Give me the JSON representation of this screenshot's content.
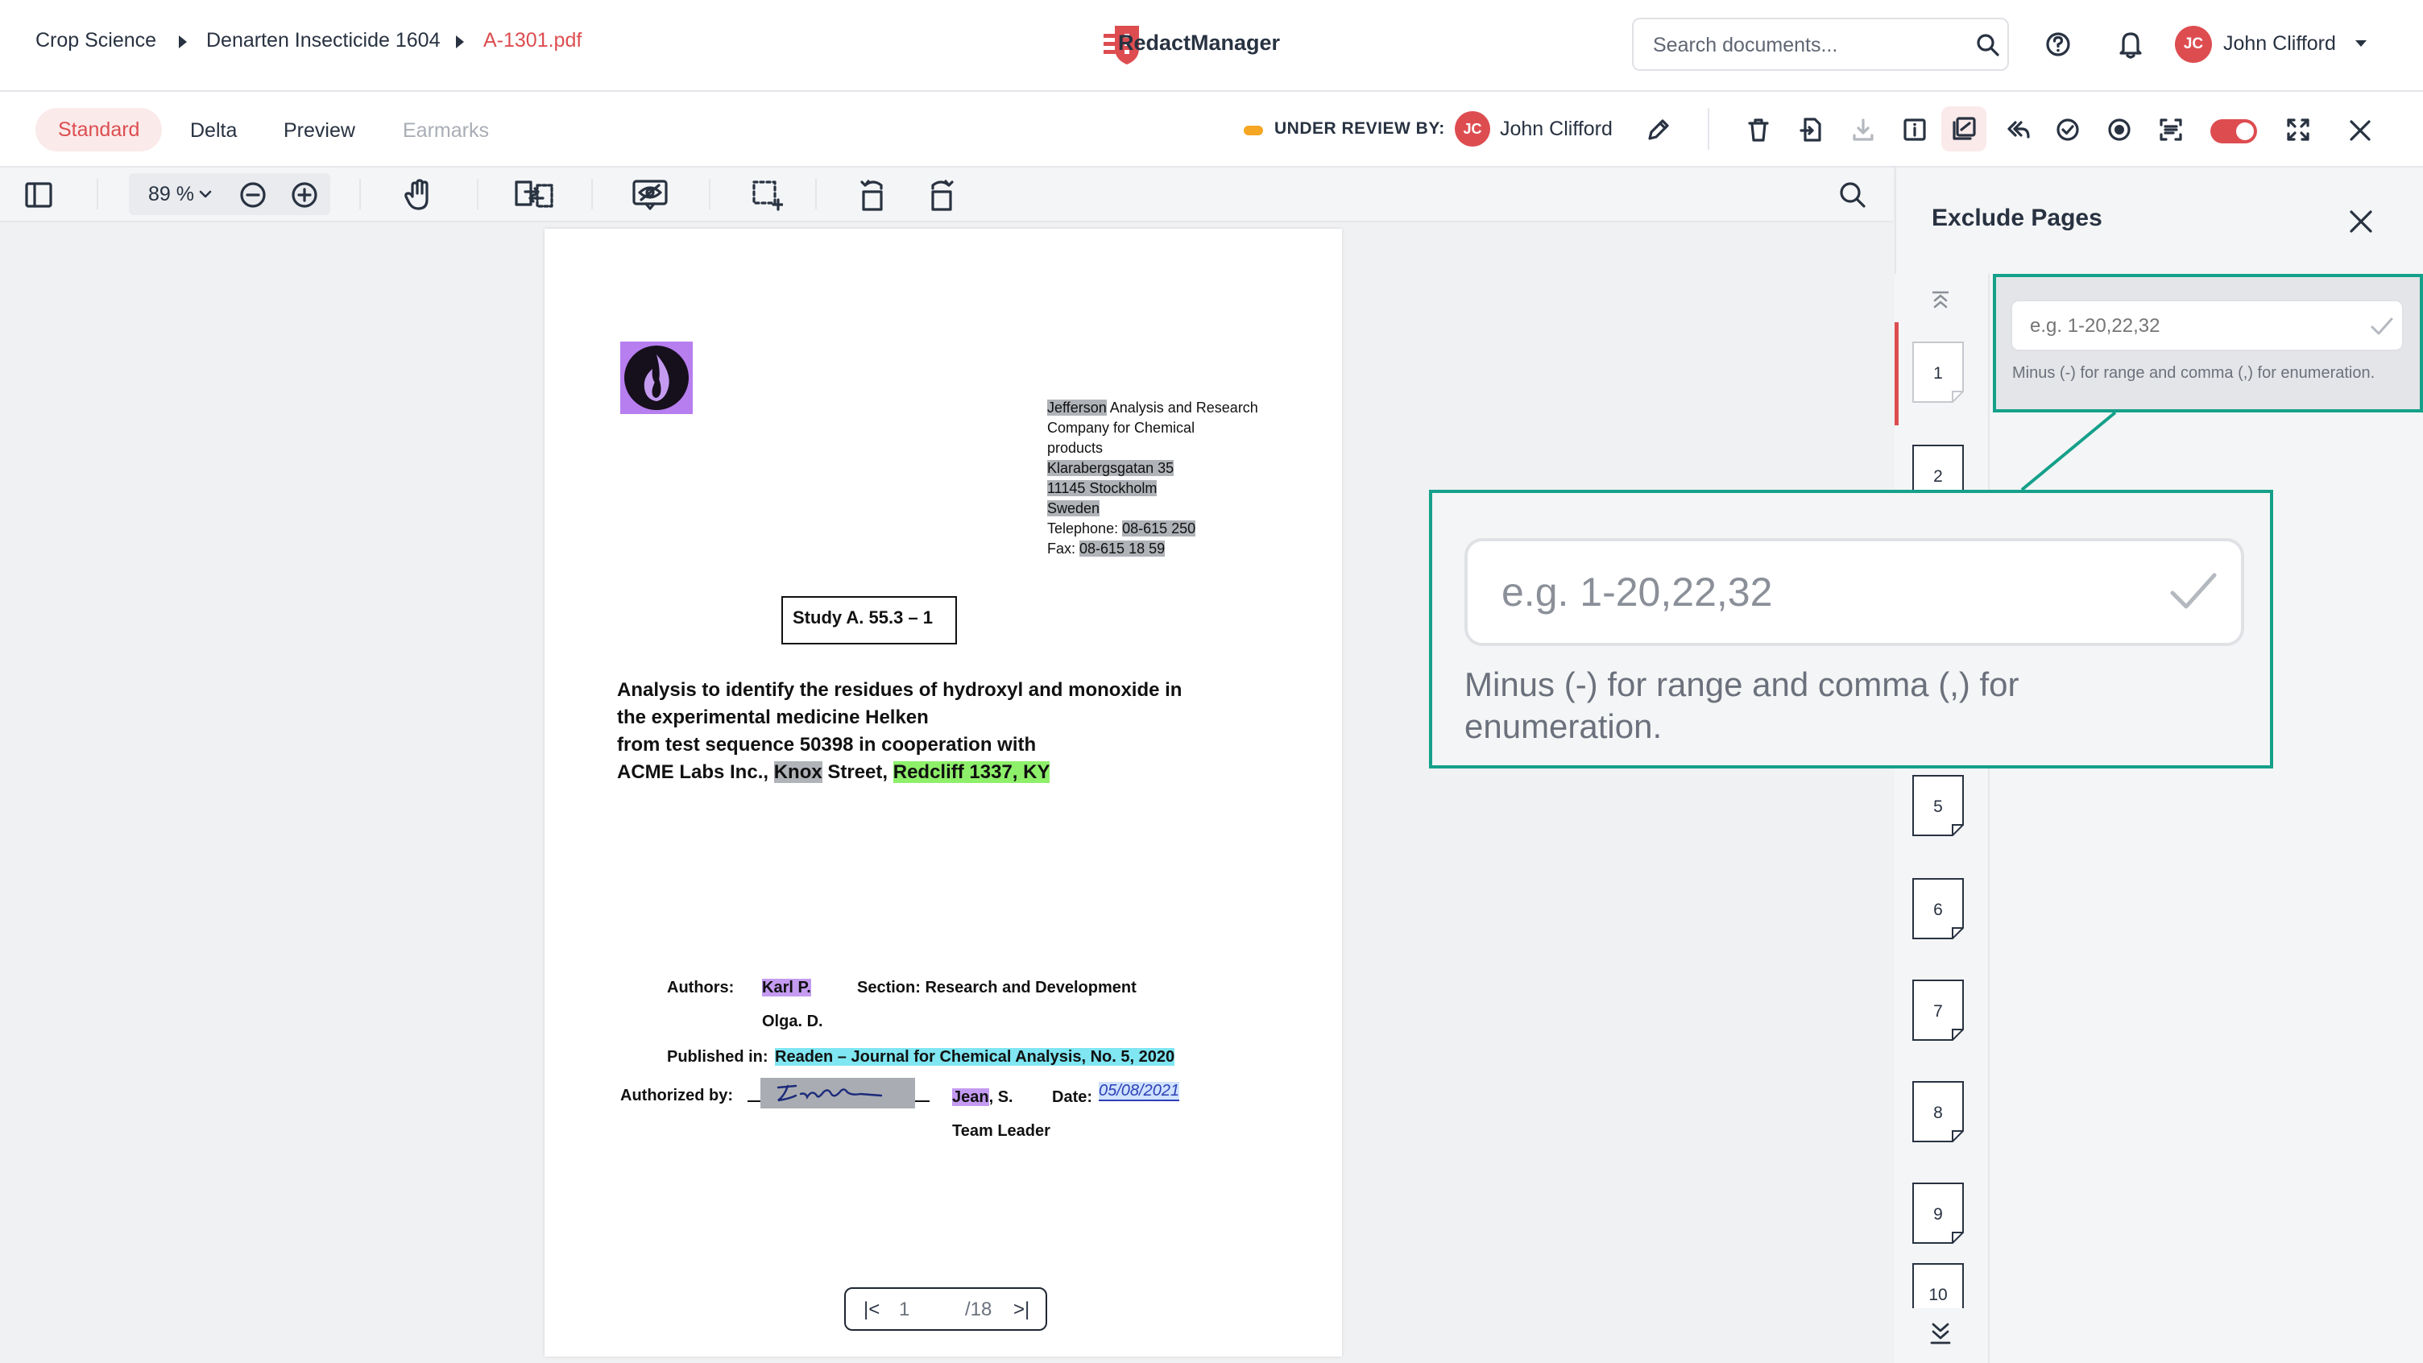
{
  "header": {
    "breadcrumb": [
      "Crop Science",
      "Denarten Insecticide 1604",
      "A-1301.pdf"
    ],
    "app_name": "RedactManager",
    "search_placeholder": "Search documents...",
    "user_initials": "JC",
    "user_name": "John Clifford"
  },
  "toolbar": {
    "tabs": [
      "Standard",
      "Delta",
      "Preview",
      "Earmarks"
    ],
    "active_tab": "Standard",
    "status_label": "UNDER REVIEW BY:",
    "reviewer_initials": "JC",
    "reviewer_name": "John Clifford",
    "accent_color": "#dd4d50"
  },
  "viewer": {
    "zoom": "89 %",
    "page_current": "1",
    "page_total": "/18"
  },
  "document": {
    "company": [
      "Jefferson",
      " Analysis and Research",
      "Company for Chemical",
      "products",
      "Klarabergsgatan 35",
      "11145 Stockholm",
      "Sweden",
      "Telephone: ",
      "08-615 250",
      "Fax: ",
      "08-615 18 59"
    ],
    "study": "Study A. 55.3 – 1",
    "title_lines": [
      "Analysis to identify the residues of hydroxyl and monoxide in",
      "the experimental medicine Helken",
      "from test sequence 50398 in cooperation with"
    ],
    "title_last": [
      "ACME Labs Inc., ",
      "Knox",
      " Street, ",
      "Redcliff 1337, KY"
    ],
    "authors_label": "Authors:",
    "author_1": "Karl P.",
    "section": "Section: Research and Development",
    "author_2": "Olga. D.",
    "published_label": "Published in:",
    "published_value": "Readen – Journal for Chemical Analysis, No. 5, 2020",
    "authorized_label": "Authorized by:",
    "signer": "Jean",
    "signer_suffix": ", S.",
    "date_label": "Date:",
    "date_value": "05/08/2021",
    "role": "Team Leader"
  },
  "exclude_pages": {
    "title": "Exclude Pages",
    "input_placeholder": "e.g. 1-20,22,32",
    "hint": "Minus (-) for range and comma (,) for enumeration.",
    "hint_line1": "Minus (-) for range and comma (,) for",
    "hint_line2": "enumeration.",
    "pages": [
      "1",
      "2",
      "5",
      "6",
      "7",
      "8",
      "9",
      "10"
    ]
  }
}
